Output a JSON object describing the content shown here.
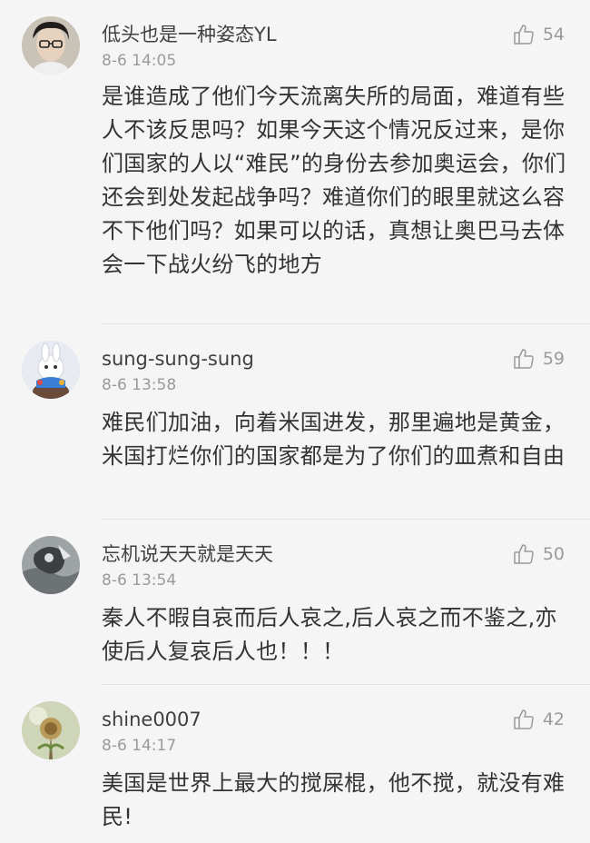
{
  "comments": [
    {
      "username": "低头也是一种姿态YL",
      "time": "8-6 14:05",
      "likes": "54",
      "text": "是谁造成了他们今天流离失所的局面，难道有些人不该反思吗？如果今天这个情况反过来，是你们国家的人以“难民”的身份去参加奥运会，你们还会到处发起战争吗？难道你们的眼里就这么容不下他们吗？如果可以的话，真想让奥巴马去体会一下战火纷飞的地方"
    },
    {
      "username": "sung-sung-sung",
      "time": "8-6 13:58",
      "likes": "59",
      "text": "难民们加油，向着米国进发，那里遍地是黄金，米国打烂你们的国家都是为了你们的皿煮和自由"
    },
    {
      "username": "忘机说天天就是天天",
      "time": "8-6 13:54",
      "likes": "50",
      "text": "秦人不暇自哀而后人哀之,后人哀之而不鉴之,亦使后人复哀后人也！！！"
    },
    {
      "username": "shine0007",
      "time": "8-6 14:17",
      "likes": "42",
      "text": "美国是世界上最大的搅屎棍，他不搅，就没有难民!"
    }
  ],
  "icons": {
    "like": "thumbs-up-icon",
    "avatar": "avatar"
  },
  "colors": {
    "background": "#f6f5f6",
    "text": "#333333",
    "muted": "#9a9a9a",
    "divider": "#e3e2e3"
  }
}
